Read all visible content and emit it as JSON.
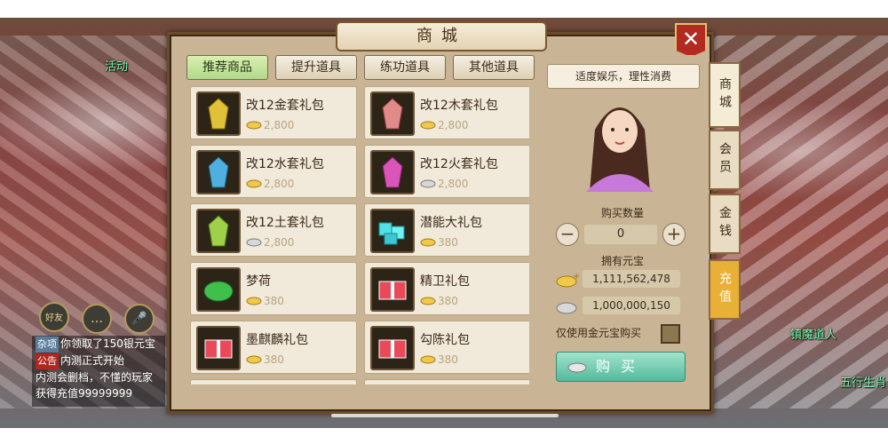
{
  "title": "商城",
  "close_label": "✕",
  "tabs": [
    {
      "label": "推荐商品",
      "active": true
    },
    {
      "label": "提升道具",
      "active": false
    },
    {
      "label": "练功道具",
      "active": false
    },
    {
      "label": "其他道具",
      "active": false
    }
  ],
  "items": [
    {
      "name": "改12金套礼包",
      "price": "2,800",
      "currency": "gold",
      "icon": "gold-robe-icon"
    },
    {
      "name": "改12木套礼包",
      "price": "2,800",
      "currency": "gold",
      "icon": "pink-robe-icon"
    },
    {
      "name": "改12水套礼包",
      "price": "2,800",
      "currency": "gold",
      "icon": "blue-robe-icon"
    },
    {
      "name": "改12火套礼包",
      "price": "2,800",
      "currency": "silver",
      "icon": "magenta-robe-icon"
    },
    {
      "name": "改12土套礼包",
      "price": "2,800",
      "currency": "silver",
      "icon": "green-robe-icon"
    },
    {
      "name": "潜能大礼包",
      "price": "380",
      "currency": "gold",
      "icon": "cyan-crystal-icon"
    },
    {
      "name": "梦荷",
      "price": "380",
      "currency": "gold",
      "icon": "lotus-leaf-icon"
    },
    {
      "name": "精卫礼包",
      "price": "380",
      "currency": "gold",
      "icon": "gift-box-icon"
    },
    {
      "name": "墨麒麟礼包",
      "price": "380",
      "currency": "gold",
      "icon": "gift-box-icon"
    },
    {
      "name": "勾陈礼包",
      "price": "380",
      "currency": "gold",
      "icon": "gift-box-icon"
    }
  ],
  "right": {
    "notice": "适度娱乐，理性消费",
    "qty_label": "购买数量",
    "qty_value": "0",
    "minus": "−",
    "plus": "+",
    "owned_label": "拥有元宝",
    "gold_owned": "1,111,562,478",
    "silver_owned": "1,000,000,150",
    "gold_only_label": "仅使用金元宝购买",
    "buy_label": "购买"
  },
  "side_tabs": [
    {
      "label": "商城",
      "active": true
    },
    {
      "label": "会员",
      "active": false
    },
    {
      "label": "金钱",
      "active": false
    },
    {
      "label": "充值",
      "active": false
    }
  ],
  "scene": {
    "top_left_label": "活动",
    "right_npc_label": "镇魔道人",
    "right_npc2_label": "五行生肖",
    "friends_label": "好友",
    "chat": [
      {
        "tag": "杂项",
        "text": "你领取了150银元宝"
      },
      {
        "tag": "公告",
        "text": "内测正式开始"
      },
      {
        "tag": "",
        "text": "内测会删档，不懂的玩家"
      },
      {
        "tag": "",
        "text": "获得充值99999999"
      }
    ]
  },
  "colors": {
    "panel_bg": "#c9b595",
    "tab_active": "#b2d98a",
    "buy_button": "#55b99b",
    "close_button": "#b32a20",
    "recharge_tab": "#e9b037"
  }
}
